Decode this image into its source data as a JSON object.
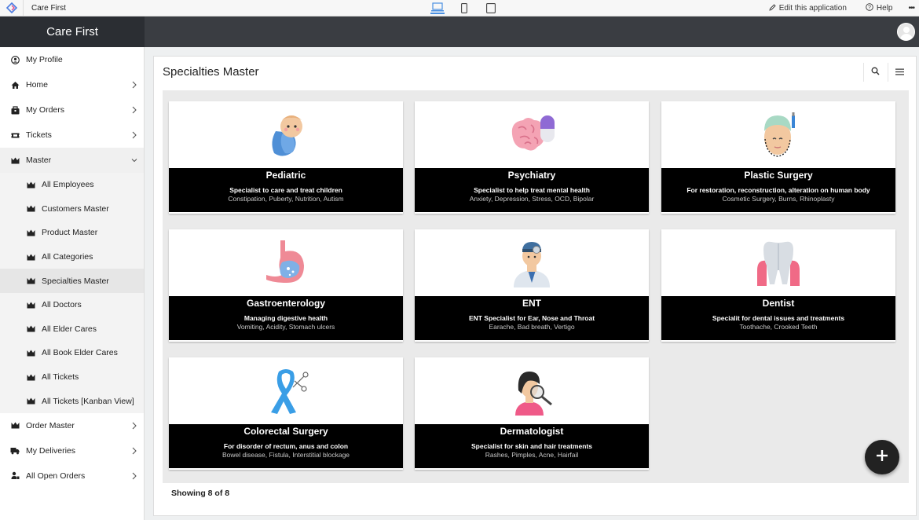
{
  "topbar": {
    "app_name": "Care First",
    "edit_label": "Edit this application",
    "help_label": "Help",
    "more_label": "•••"
  },
  "brand": {
    "title": "Care First"
  },
  "sidebar": {
    "items": [
      {
        "label": "My Profile",
        "icon": "user-circle-icon"
      },
      {
        "label": "Home",
        "icon": "home-icon"
      },
      {
        "label": "My Orders",
        "icon": "orders-icon"
      },
      {
        "label": "Tickets",
        "icon": "ticket-icon"
      },
      {
        "label": "Master",
        "icon": "crown-icon"
      },
      {
        "label": "Order Master",
        "icon": "crown-icon"
      },
      {
        "label": "My Deliveries",
        "icon": "truck-icon"
      },
      {
        "label": "All Open Orders",
        "icon": "user-orders-icon"
      }
    ],
    "master_sub": [
      "All Employees",
      "Customers Master",
      "Product Master",
      "All Categories",
      "Specialties Master",
      "All Doctors",
      "All Elder Cares",
      "All Book Elder Cares",
      "All Tickets",
      "All Tickets [Kanban View]"
    ]
  },
  "main": {
    "title": "Specialties Master",
    "footer": "Showing 8 of 8",
    "cards": [
      {
        "name": "Pediatric",
        "desc": "Specialist to care and treat children",
        "tags": "Constipation, Puberty, Nutrition, Autism",
        "icon": "baby-icon"
      },
      {
        "name": "Psychiatry",
        "desc": "Specialist to help treat mental health",
        "tags": "Anxiety, Depression, Stress, OCD, Bipolar",
        "icon": "brain-icon"
      },
      {
        "name": "Plastic Surgery",
        "desc": "For restoration, reconstruction, alteration on human body",
        "tags": "Cosmetic Surgery, Burns, Rhinoplasty",
        "icon": "face-surgery-icon"
      },
      {
        "name": "Gastroenterology",
        "desc": "Managing digestive health",
        "tags": "Vomiting, Acidity, Stomach ulcers",
        "icon": "stomach-icon"
      },
      {
        "name": "ENT",
        "desc": "ENT Specialist for Ear, Nose and Throat",
        "tags": "Earache, Bad breath, Vertigo",
        "icon": "ent-doctor-icon"
      },
      {
        "name": "Dentist",
        "desc": "Specialit for dental issues and treatments",
        "tags": "Toothache, Crooked Teeth",
        "icon": "tooth-icon"
      },
      {
        "name": "Colorectal Surgery",
        "desc": "For disorder of rectum, anus and colon",
        "tags": "Bowel disease, Fistula, Interstitial blockage",
        "icon": "ribbon-icon"
      },
      {
        "name": "Dermatologist",
        "desc": "Specialist for skin and hair treatments",
        "tags": "Rashes, Pimples, Acne, Hairfail",
        "icon": "magnifier-face-icon"
      }
    ]
  },
  "colors": {
    "sidebar_bg": "#ffffff",
    "header": "#3a3d42",
    "brand": "#2b2e33",
    "caption": "#000000",
    "fab": "#222222"
  }
}
